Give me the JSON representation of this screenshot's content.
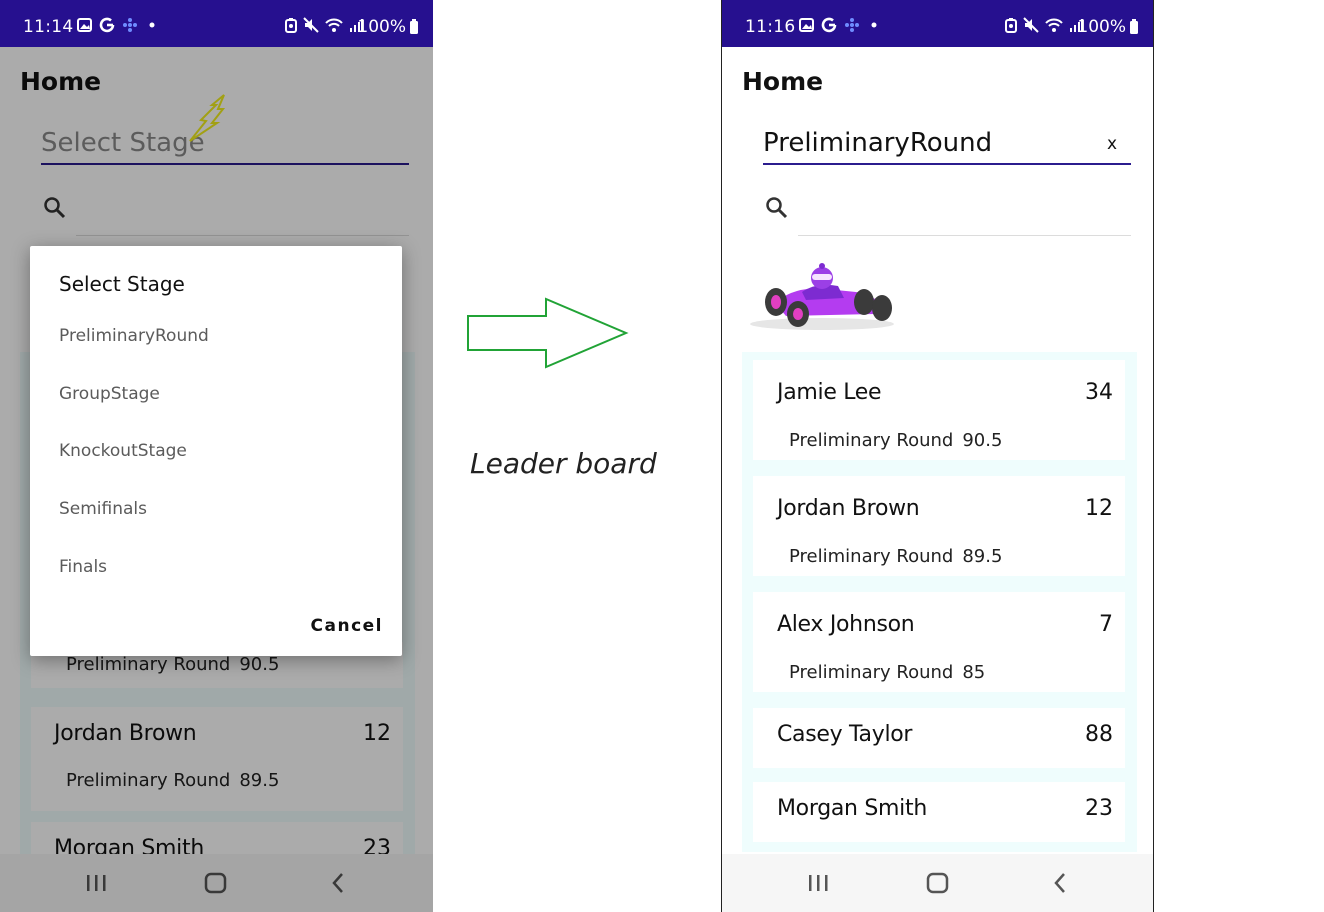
{
  "left_screen": {
    "status": {
      "time": "11:14",
      "battery": "100%"
    },
    "page_title": "Home",
    "picker": {
      "placeholder": "Select Stage"
    },
    "dialog": {
      "title": "Select Stage",
      "options": [
        "PreliminaryRound",
        "GroupStage",
        "KnockoutStage",
        "Semifinals",
        "Finals"
      ],
      "cancel_label": "Cancel"
    },
    "visible_rows": [
      {
        "round": "Preliminary Round",
        "points": "90.5"
      },
      {
        "name": "Jordan Brown",
        "score": "12",
        "round": "Preliminary Round",
        "points": "89.5"
      },
      {
        "name": "Morgan Smith",
        "score": "23"
      }
    ]
  },
  "annotation": {
    "caption": "Leader board",
    "arrow_color": "#21a336",
    "lightning_color": "#f2ef1e"
  },
  "right_screen": {
    "status": {
      "time": "11:16",
      "battery": "100%"
    },
    "page_title": "Home",
    "picker": {
      "value": "PreliminaryRound",
      "clear_label": "x"
    },
    "mascot_icon": "race-car-icon",
    "leaderboard": [
      {
        "name": "Jamie Lee",
        "score": "34",
        "round": "Preliminary Round",
        "points": "90.5"
      },
      {
        "name": "Jordan Brown",
        "score": "12",
        "round": "Preliminary Round",
        "points": "89.5"
      },
      {
        "name": "Alex Johnson",
        "score": "7",
        "round": "Preliminary Round",
        "points": "85"
      },
      {
        "name": "Casey Taylor",
        "score": "88"
      },
      {
        "name": "Morgan Smith",
        "score": "23"
      }
    ]
  },
  "colors": {
    "status_bar": "#26108f",
    "underline": "#2b1c8e",
    "board_bg": "#effdfd"
  }
}
